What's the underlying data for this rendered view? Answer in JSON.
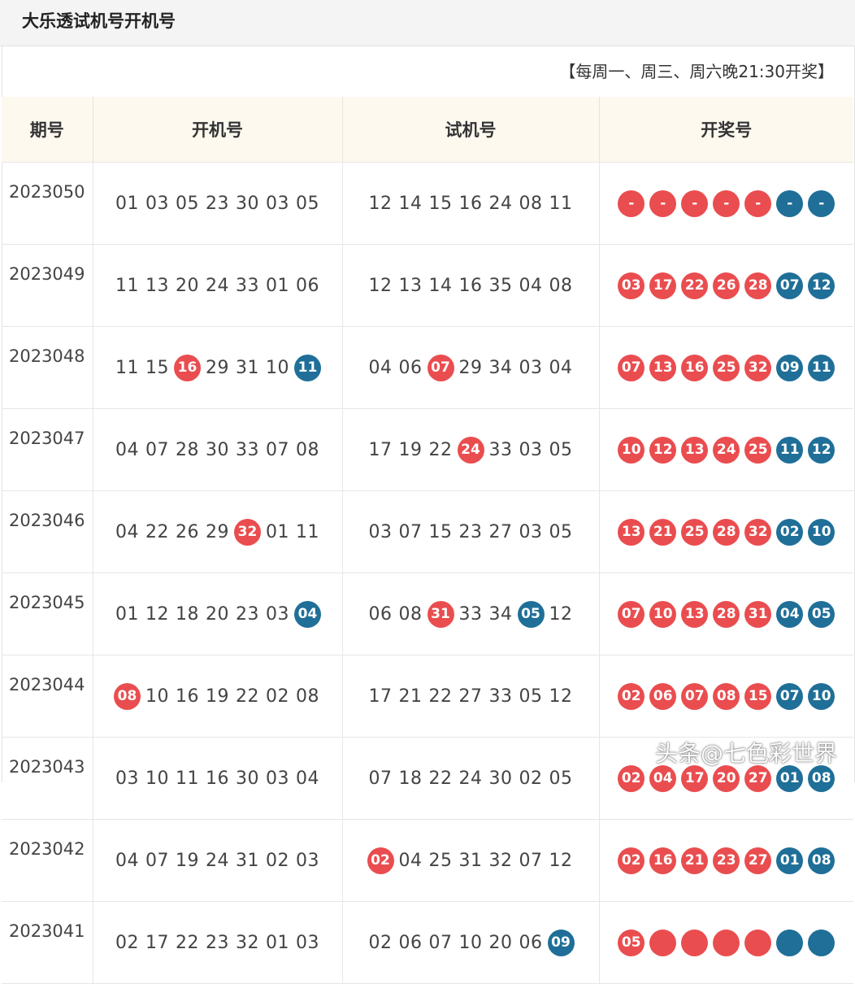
{
  "title": "大乐透试机号开机号",
  "schedule": "【每周一、周三、周六晚21:30开奖】",
  "headers": {
    "period": "期号",
    "open": "开机号",
    "trial": "试机号",
    "draw": "开奖号"
  },
  "colors": {
    "red_ball": "#ea4d4f",
    "blue_ball": "#1f6f98",
    "header_bg": "#fdf9ef"
  },
  "rows": [
    {
      "period": "2023050",
      "open": [
        {
          "n": "01"
        },
        {
          "n": "03"
        },
        {
          "n": "05"
        },
        {
          "n": "23"
        },
        {
          "n": "30"
        },
        {
          "n": "03"
        },
        {
          "n": "05"
        }
      ],
      "trial": [
        {
          "n": "12"
        },
        {
          "n": "14"
        },
        {
          "n": "15"
        },
        {
          "n": "16"
        },
        {
          "n": "24"
        },
        {
          "n": "08"
        },
        {
          "n": "11"
        }
      ],
      "draw": [
        "-",
        "-",
        "-",
        "-",
        "-",
        "-",
        "-"
      ]
    },
    {
      "period": "2023049",
      "open": [
        {
          "n": "11"
        },
        {
          "n": "13"
        },
        {
          "n": "20"
        },
        {
          "n": "24"
        },
        {
          "n": "33"
        },
        {
          "n": "01"
        },
        {
          "n": "06"
        }
      ],
      "trial": [
        {
          "n": "12"
        },
        {
          "n": "13"
        },
        {
          "n": "14"
        },
        {
          "n": "16"
        },
        {
          "n": "35"
        },
        {
          "n": "04"
        },
        {
          "n": "08"
        }
      ],
      "draw": [
        "03",
        "17",
        "22",
        "26",
        "28",
        "07",
        "12"
      ]
    },
    {
      "period": "2023048",
      "open": [
        {
          "n": "11"
        },
        {
          "n": "15"
        },
        {
          "n": "16",
          "hl": "red"
        },
        {
          "n": "29"
        },
        {
          "n": "31"
        },
        {
          "n": "10"
        },
        {
          "n": "11",
          "hl": "blue"
        }
      ],
      "trial": [
        {
          "n": "04"
        },
        {
          "n": "06"
        },
        {
          "n": "07",
          "hl": "red"
        },
        {
          "n": "29"
        },
        {
          "n": "34"
        },
        {
          "n": "03"
        },
        {
          "n": "04"
        }
      ],
      "draw": [
        "07",
        "13",
        "16",
        "25",
        "32",
        "09",
        "11"
      ]
    },
    {
      "period": "2023047",
      "open": [
        {
          "n": "04"
        },
        {
          "n": "07"
        },
        {
          "n": "28"
        },
        {
          "n": "30"
        },
        {
          "n": "33"
        },
        {
          "n": "07"
        },
        {
          "n": "08"
        }
      ],
      "trial": [
        {
          "n": "17"
        },
        {
          "n": "19"
        },
        {
          "n": "22"
        },
        {
          "n": "24",
          "hl": "red"
        },
        {
          "n": "33"
        },
        {
          "n": "03"
        },
        {
          "n": "05"
        }
      ],
      "draw": [
        "10",
        "12",
        "13",
        "24",
        "25",
        "11",
        "12"
      ]
    },
    {
      "period": "2023046",
      "open": [
        {
          "n": "04"
        },
        {
          "n": "22"
        },
        {
          "n": "26"
        },
        {
          "n": "29"
        },
        {
          "n": "32",
          "hl": "red"
        },
        {
          "n": "01"
        },
        {
          "n": "11"
        }
      ],
      "trial": [
        {
          "n": "03"
        },
        {
          "n": "07"
        },
        {
          "n": "15"
        },
        {
          "n": "23"
        },
        {
          "n": "27"
        },
        {
          "n": "03"
        },
        {
          "n": "05"
        }
      ],
      "draw": [
        "13",
        "21",
        "25",
        "28",
        "32",
        "02",
        "10"
      ]
    },
    {
      "period": "2023045",
      "open": [
        {
          "n": "01"
        },
        {
          "n": "12"
        },
        {
          "n": "18"
        },
        {
          "n": "20"
        },
        {
          "n": "23"
        },
        {
          "n": "03"
        },
        {
          "n": "04",
          "hl": "blue"
        }
      ],
      "trial": [
        {
          "n": "06"
        },
        {
          "n": "08"
        },
        {
          "n": "31",
          "hl": "red"
        },
        {
          "n": "33"
        },
        {
          "n": "34"
        },
        {
          "n": "05",
          "hl": "blue"
        },
        {
          "n": "12"
        }
      ],
      "draw": [
        "07",
        "10",
        "13",
        "28",
        "31",
        "04",
        "05"
      ]
    },
    {
      "period": "2023044",
      "open": [
        {
          "n": "08",
          "hl": "red"
        },
        {
          "n": "10"
        },
        {
          "n": "16"
        },
        {
          "n": "19"
        },
        {
          "n": "22"
        },
        {
          "n": "02"
        },
        {
          "n": "08"
        }
      ],
      "trial": [
        {
          "n": "17"
        },
        {
          "n": "21"
        },
        {
          "n": "22"
        },
        {
          "n": "27"
        },
        {
          "n": "33"
        },
        {
          "n": "05"
        },
        {
          "n": "12"
        }
      ],
      "draw": [
        "02",
        "06",
        "07",
        "08",
        "15",
        "07",
        "10"
      ]
    },
    {
      "period": "2023043",
      "open": [
        {
          "n": "03"
        },
        {
          "n": "10"
        },
        {
          "n": "11"
        },
        {
          "n": "16"
        },
        {
          "n": "30"
        },
        {
          "n": "03"
        },
        {
          "n": "04"
        }
      ],
      "trial": [
        {
          "n": "07"
        },
        {
          "n": "18"
        },
        {
          "n": "22"
        },
        {
          "n": "24"
        },
        {
          "n": "30"
        },
        {
          "n": "02"
        },
        {
          "n": "05"
        }
      ],
      "draw": [
        "02",
        "04",
        "17",
        "20",
        "27",
        "01",
        "08"
      ]
    },
    {
      "period": "2023042",
      "open": [
        {
          "n": "04"
        },
        {
          "n": "07"
        },
        {
          "n": "19"
        },
        {
          "n": "24"
        },
        {
          "n": "31"
        },
        {
          "n": "02"
        },
        {
          "n": "03"
        }
      ],
      "trial": [
        {
          "n": "02",
          "hl": "red"
        },
        {
          "n": "04"
        },
        {
          "n": "25"
        },
        {
          "n": "31"
        },
        {
          "n": "32"
        },
        {
          "n": "07"
        },
        {
          "n": "12"
        }
      ],
      "draw": [
        "02",
        "16",
        "21",
        "23",
        "27",
        "01",
        "08"
      ]
    },
    {
      "period": "2023041",
      "open": [
        {
          "n": "02"
        },
        {
          "n": "17"
        },
        {
          "n": "22"
        },
        {
          "n": "23"
        },
        {
          "n": "32"
        },
        {
          "n": "01"
        },
        {
          "n": "03"
        }
      ],
      "trial": [
        {
          "n": "02"
        },
        {
          "n": "06"
        },
        {
          "n": "07"
        },
        {
          "n": "10"
        },
        {
          "n": "20"
        },
        {
          "n": "06"
        },
        {
          "n": "09",
          "hl": "blue"
        }
      ],
      "draw": [
        "05",
        "",
        "",
        "",
        "",
        "",
        ""
      ]
    }
  ],
  "watermark": "头条@七色彩世界"
}
